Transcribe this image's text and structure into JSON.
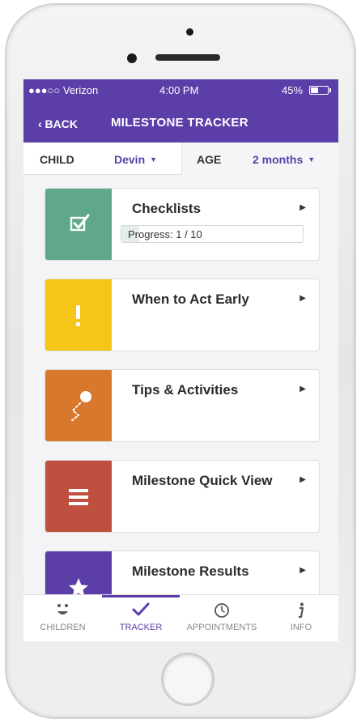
{
  "status_bar": {
    "carrier": "●●●○○ Verizon",
    "time": "4:00 PM",
    "battery": "45%",
    "battery_level": 0.45
  },
  "nav": {
    "back_label": "‹ BACK",
    "title": "MILESTONE  TRACKER"
  },
  "selector": {
    "child_label": "CHILD",
    "child_value": "Devin",
    "age_label": "AGE",
    "age_value": "2 months"
  },
  "cards": [
    {
      "title": "Checklists",
      "color": "#5fa98a",
      "icon": "checkbox-icon",
      "progress_text": "Progress: 1 / 10",
      "progress_value": 0.1
    },
    {
      "title": "When to Act Early",
      "color": "#f5c518",
      "icon": "exclamation-icon"
    },
    {
      "title": "Tips & Activities",
      "color": "#d8782d",
      "icon": "path-dot-icon"
    },
    {
      "title": "Milestone Quick View",
      "color": "#bf4f3f",
      "icon": "list-icon"
    },
    {
      "title": "Milestone Results",
      "color": "#5b3ea8",
      "icon": "star-icon"
    }
  ],
  "tabs": [
    {
      "label": "CHILDREN",
      "icon": "smiley-icon",
      "active": false
    },
    {
      "label": "TRACKER",
      "icon": "checkmark-icon",
      "active": true
    },
    {
      "label": "APPOINTMENTS",
      "icon": "clock-icon",
      "active": false
    },
    {
      "label": "INFO",
      "icon": "info-icon",
      "active": false
    }
  ],
  "colors": {
    "brand_purple": "#5b3ea8"
  }
}
